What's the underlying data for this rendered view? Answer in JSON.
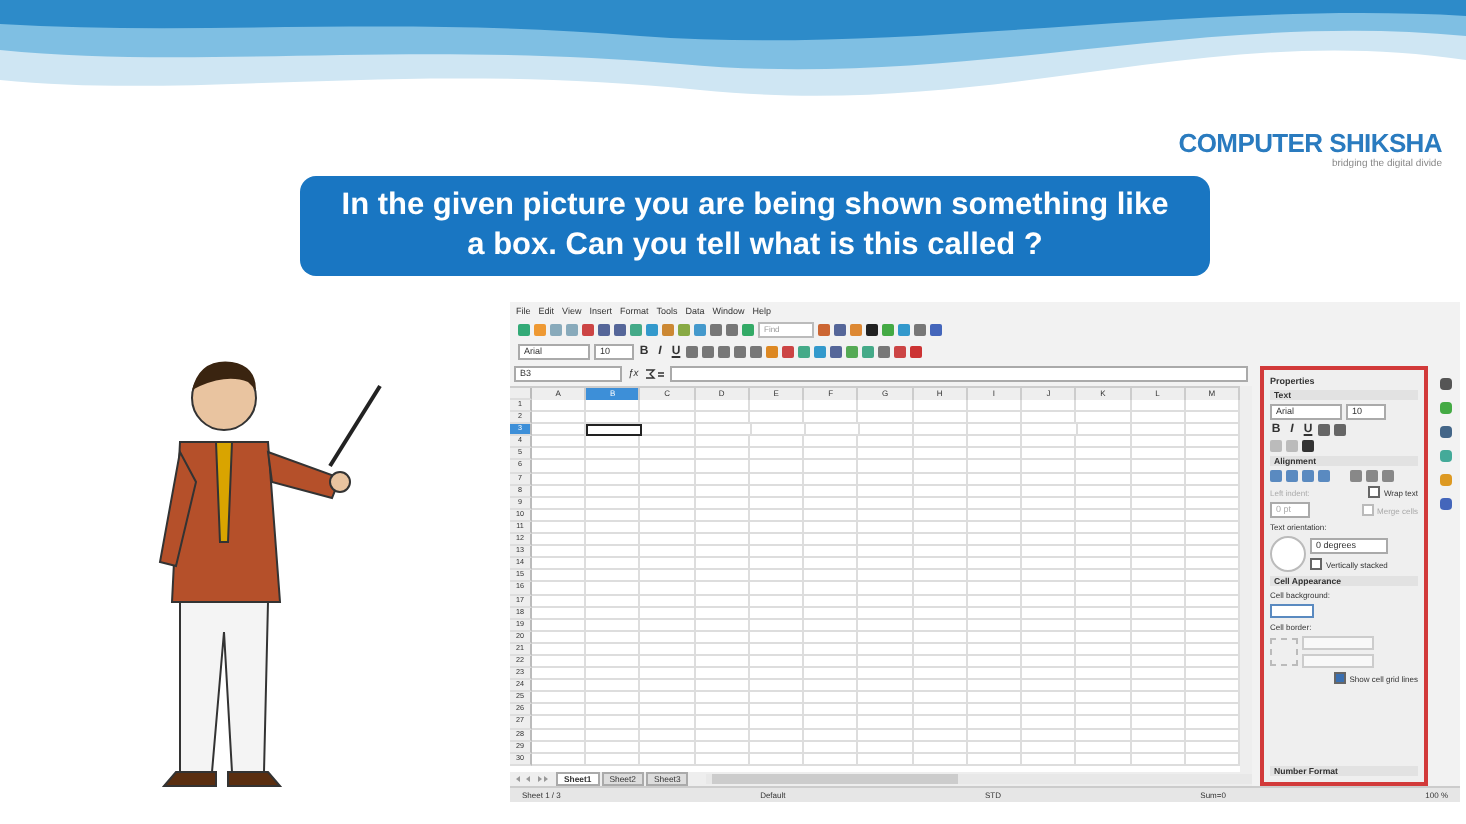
{
  "logo": {
    "name": "COMPUTER SHIKSHA",
    "tagline": "bridging the digital divide"
  },
  "question": "In the given picture you are being shown something like a box. Can you tell what is this called ?",
  "spreadsheet": {
    "menu": [
      "File",
      "Edit",
      "View",
      "Insert",
      "Format",
      "Tools",
      "Data",
      "Window",
      "Help"
    ],
    "find_field": {
      "placeholder": "Find"
    },
    "font_name": "Arial",
    "font_size": "10",
    "format_buttons": [
      "B",
      "I",
      "U"
    ],
    "name_box": "B3",
    "function_wizard": "ƒx",
    "columns": [
      {
        "label": "A",
        "selected": false
      },
      {
        "label": "B",
        "selected": true
      },
      {
        "label": "C",
        "selected": false
      },
      {
        "label": "D",
        "selected": false
      },
      {
        "label": "E",
        "selected": false
      },
      {
        "label": "F",
        "selected": false
      },
      {
        "label": "G",
        "selected": false
      },
      {
        "label": "H",
        "selected": false
      },
      {
        "label": "I",
        "selected": false
      },
      {
        "label": "J",
        "selected": false
      },
      {
        "label": "K",
        "selected": false
      },
      {
        "label": "L",
        "selected": false
      },
      {
        "label": "M",
        "selected": false
      }
    ],
    "rows": [
      {
        "label": "1",
        "selected": false
      },
      {
        "label": "2",
        "selected": false
      },
      {
        "label": "3",
        "selected": true
      },
      {
        "label": "4",
        "selected": false
      },
      {
        "label": "5",
        "selected": false
      },
      {
        "label": "6",
        "selected": false
      },
      {
        "label": "7",
        "selected": false
      },
      {
        "label": "8",
        "selected": false
      },
      {
        "label": "9",
        "selected": false
      },
      {
        "label": "10",
        "selected": false
      },
      {
        "label": "11",
        "selected": false
      },
      {
        "label": "12",
        "selected": false
      },
      {
        "label": "13",
        "selected": false
      },
      {
        "label": "14",
        "selected": false
      },
      {
        "label": "15",
        "selected": false
      },
      {
        "label": "16",
        "selected": false
      },
      {
        "label": "17",
        "selected": false
      },
      {
        "label": "18",
        "selected": false
      },
      {
        "label": "19",
        "selected": false
      },
      {
        "label": "20",
        "selected": false
      },
      {
        "label": "21",
        "selected": false
      },
      {
        "label": "22",
        "selected": false
      },
      {
        "label": "23",
        "selected": false
      },
      {
        "label": "24",
        "selected": false
      },
      {
        "label": "25",
        "selected": false
      },
      {
        "label": "26",
        "selected": false
      },
      {
        "label": "27",
        "selected": false
      },
      {
        "label": "28",
        "selected": false
      },
      {
        "label": "29",
        "selected": false
      },
      {
        "label": "30",
        "selected": false
      }
    ],
    "sheet_tabs": [
      {
        "label": "Sheet1",
        "selected": true
      },
      {
        "label": "Sheet2",
        "selected": false
      },
      {
        "label": "Sheet3",
        "selected": false
      }
    ],
    "status_bar": {
      "sheet": "Sheet 1 / 3",
      "style": "Default",
      "mode": "STD",
      "sum": "Sum=0",
      "zoom": "100 %"
    },
    "sidebar": {
      "title": "Properties",
      "text_section": {
        "title": "Text",
        "font": "Arial",
        "size": "10",
        "buttons": [
          "B",
          "I",
          "U"
        ]
      },
      "alignment_section": {
        "title": "Alignment",
        "left_indent_label": "Left indent:",
        "left_indent": "0 pt",
        "wrap_text": {
          "label": "Wrap text",
          "checked": false
        },
        "merge_cells": {
          "label": "Merge cells",
          "checked": false
        },
        "orientation_label": "Text orientation:",
        "orientation": "0 degrees",
        "vertically_stacked": {
          "label": "Vertically stacked",
          "checked": false
        }
      },
      "appearance_section": {
        "title": "Cell Appearance",
        "background_label": "Cell background:",
        "border_label": "Cell border:",
        "grid_lines": {
          "label": "Show cell grid lines",
          "checked": true
        }
      },
      "number_section": {
        "title": "Number Format"
      }
    }
  }
}
